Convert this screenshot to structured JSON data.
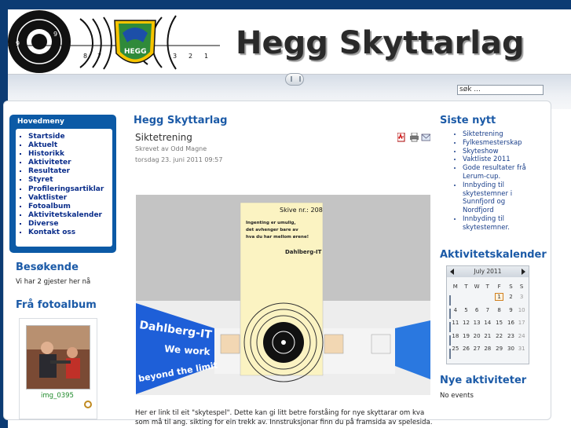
{
  "site": {
    "name": "Hegg Skyttarlag",
    "search_placeholder": "søk ..."
  },
  "header": {
    "target_numbers_left": [
      "9",
      "10",
      "9",
      "8",
      "7"
    ],
    "target_numbers_right": [
      "3",
      "2",
      "1"
    ],
    "emblem_text": "HEGG"
  },
  "left": {
    "menu_title": "Hovedmeny",
    "menu_items": [
      "Startside",
      "Aktuelt",
      "Historikk",
      "Aktiviteter",
      "Resultater",
      "Styret",
      "Profileringsartiklar",
      "Vaktlister",
      "Fotoalbum",
      "Aktivitetskalender",
      "Diverse",
      "Kontakt oss"
    ],
    "visitors_title": "Besøkende",
    "visitors_text": "Vi har 2 gjester her nå",
    "album_title": "Frå fotoalbum",
    "album_caption": "img_0395"
  },
  "main": {
    "section_title": "Hegg Skyttarlag",
    "article_title": "Siktetrening",
    "author": "Skrevet av Odd Magne",
    "date": "torsdag 23. juni 2011 09:57",
    "icons": [
      "pdf-icon",
      "print-icon",
      "email-icon"
    ],
    "image": {
      "disc_label": "Skive nr.: 208",
      "quote_lines": [
        "Ingenting er umulig,",
        "det avhenger bare av",
        "hva du har mellom ørene!"
      ],
      "brand": "Dahlberg-IT",
      "left_wall_lines": [
        "Dahlberg-IT",
        "We work",
        "beyond the limit"
      ]
    },
    "body": "Her er link til eit \"skytespel\". Dette kan gi litt betre forståing for nye skyttarar om kva som må til ang. sikting for ein trekk av. Innstruksjonar finn du på framsida av spelesida."
  },
  "right": {
    "news_title": "Siste nytt",
    "news_items": [
      "Siktetrening",
      "Fylkesmesterskap",
      "Skyteshow",
      "Vaktliste 2011",
      "Gode resultater frå Lerum-cup.",
      "Innbyding til skytestemner i Sunnfjord og Nordfjord",
      "Innbyding til skytestemner."
    ],
    "calendar_title": "Aktivitetskalender",
    "calendar": {
      "month": "July 2011",
      "weekdays": [
        "M",
        "T",
        "W",
        "T",
        "F",
        "S",
        "S"
      ],
      "rows": [
        [
          "",
          "",
          "",
          "",
          "1",
          "2",
          "3"
        ],
        [
          "4",
          "5",
          "6",
          "7",
          "8",
          "9",
          "10"
        ],
        [
          "11",
          "12",
          "13",
          "14",
          "15",
          "16",
          "17"
        ],
        [
          "18",
          "19",
          "20",
          "21",
          "22",
          "23",
          "24"
        ],
        [
          "25",
          "26",
          "27",
          "28",
          "29",
          "30",
          "31"
        ]
      ],
      "today": "1"
    },
    "events_title": "Nye aktiviteter",
    "events_text": "No events"
  }
}
